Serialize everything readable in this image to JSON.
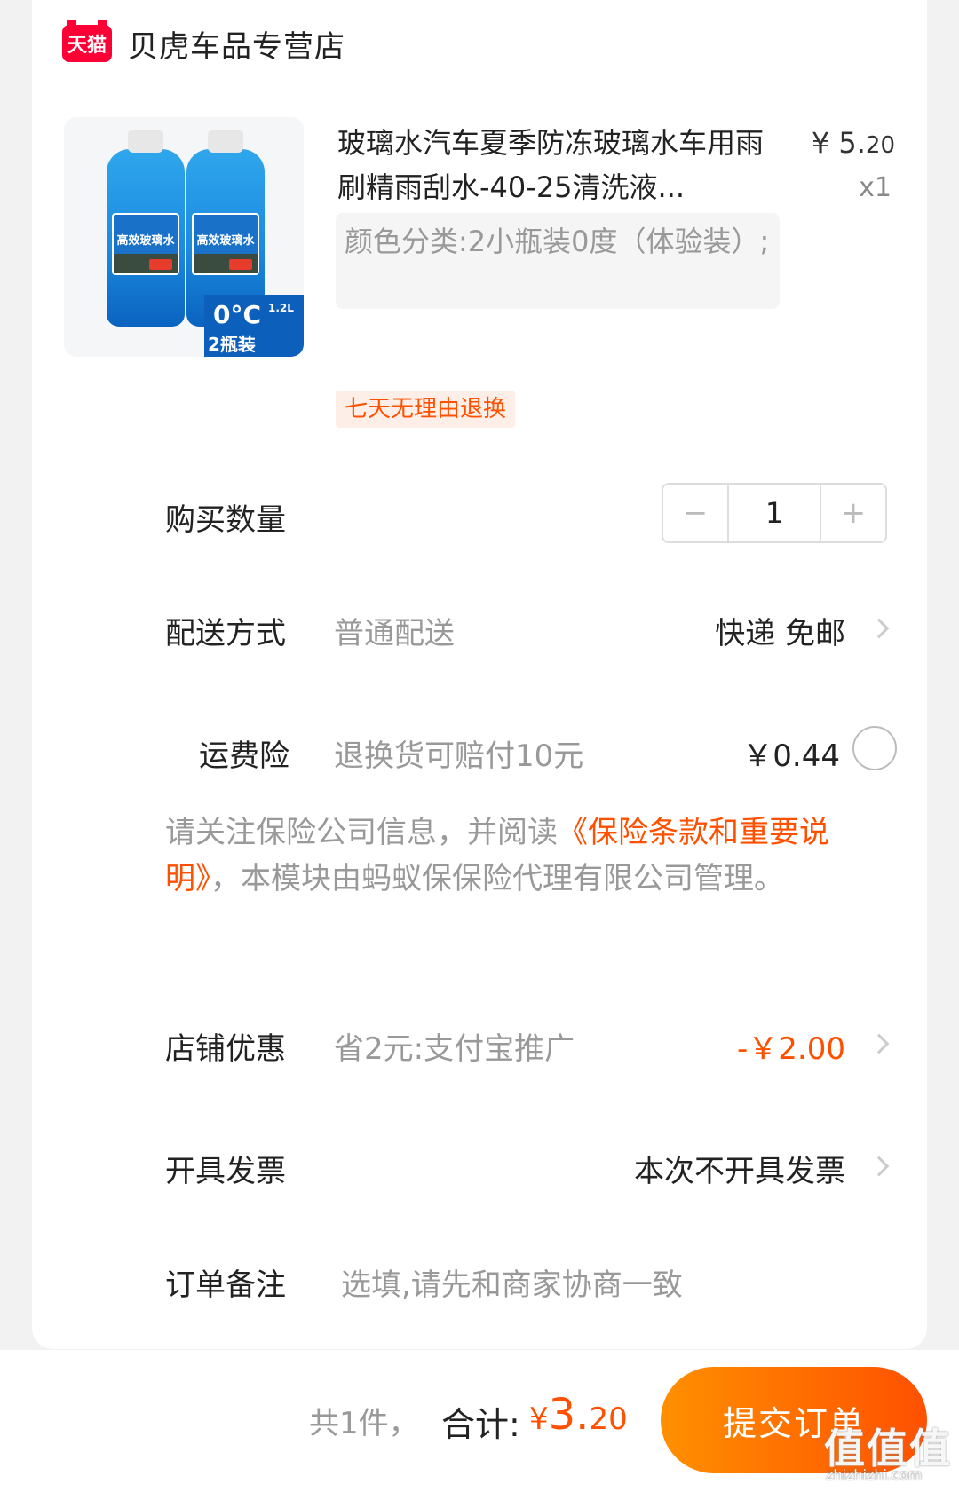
{
  "shop": {
    "logo_text": "天猫",
    "name": "贝虎车品专营店"
  },
  "product": {
    "title": "玻璃水汽车夏季防冻玻璃水车用雨刷精雨刮水-40-25清洗液...",
    "price_symbol": "¥",
    "price_int": "5.",
    "price_dec": "20",
    "qty": "x1",
    "sku": "颜色分类:2小瓶装0度（体验装）;",
    "return_tag": "七天无理由退换",
    "image_texts": {
      "bottle_label": "高效玻璃水",
      "temp": "0°C",
      "volume": "1.2L",
      "pack": "2瓶装"
    }
  },
  "quantity": {
    "label": "购买数量",
    "minus": "−",
    "value": "1",
    "plus": "+"
  },
  "delivery": {
    "label": "配送方式",
    "method": "普通配送",
    "value": "快递 免邮"
  },
  "shipping_insurance": {
    "label": "运费险",
    "desc": "退换货可赔付10元",
    "price": "￥0.44"
  },
  "notice": {
    "pre": "请关注保险公司信息，并阅读",
    "link": "《保险条款和重要说明》",
    "post": "，本模块由蚂蚁保保险代理有限公司管理。"
  },
  "store_discount": {
    "label": "店铺优惠",
    "desc": "省2元:支付宝推广",
    "value": "-￥2.00"
  },
  "invoice": {
    "label": "开具发票",
    "value": "本次不开具发票"
  },
  "remark": {
    "label": "订单备注",
    "placeholder": "选填,请先和商家协商一致"
  },
  "footer": {
    "count_text": "共1件，",
    "total_label": "合计:",
    "total_symbol": "¥",
    "total_int": "3.",
    "total_dec": "20",
    "submit_label": "提交订单"
  },
  "watermark": {
    "glyph": "值",
    "site": "zhizhizhi.com"
  },
  "colors": {
    "accent": "#ff5000",
    "tmall_red": "#ff0036",
    "muted": "#999999"
  }
}
